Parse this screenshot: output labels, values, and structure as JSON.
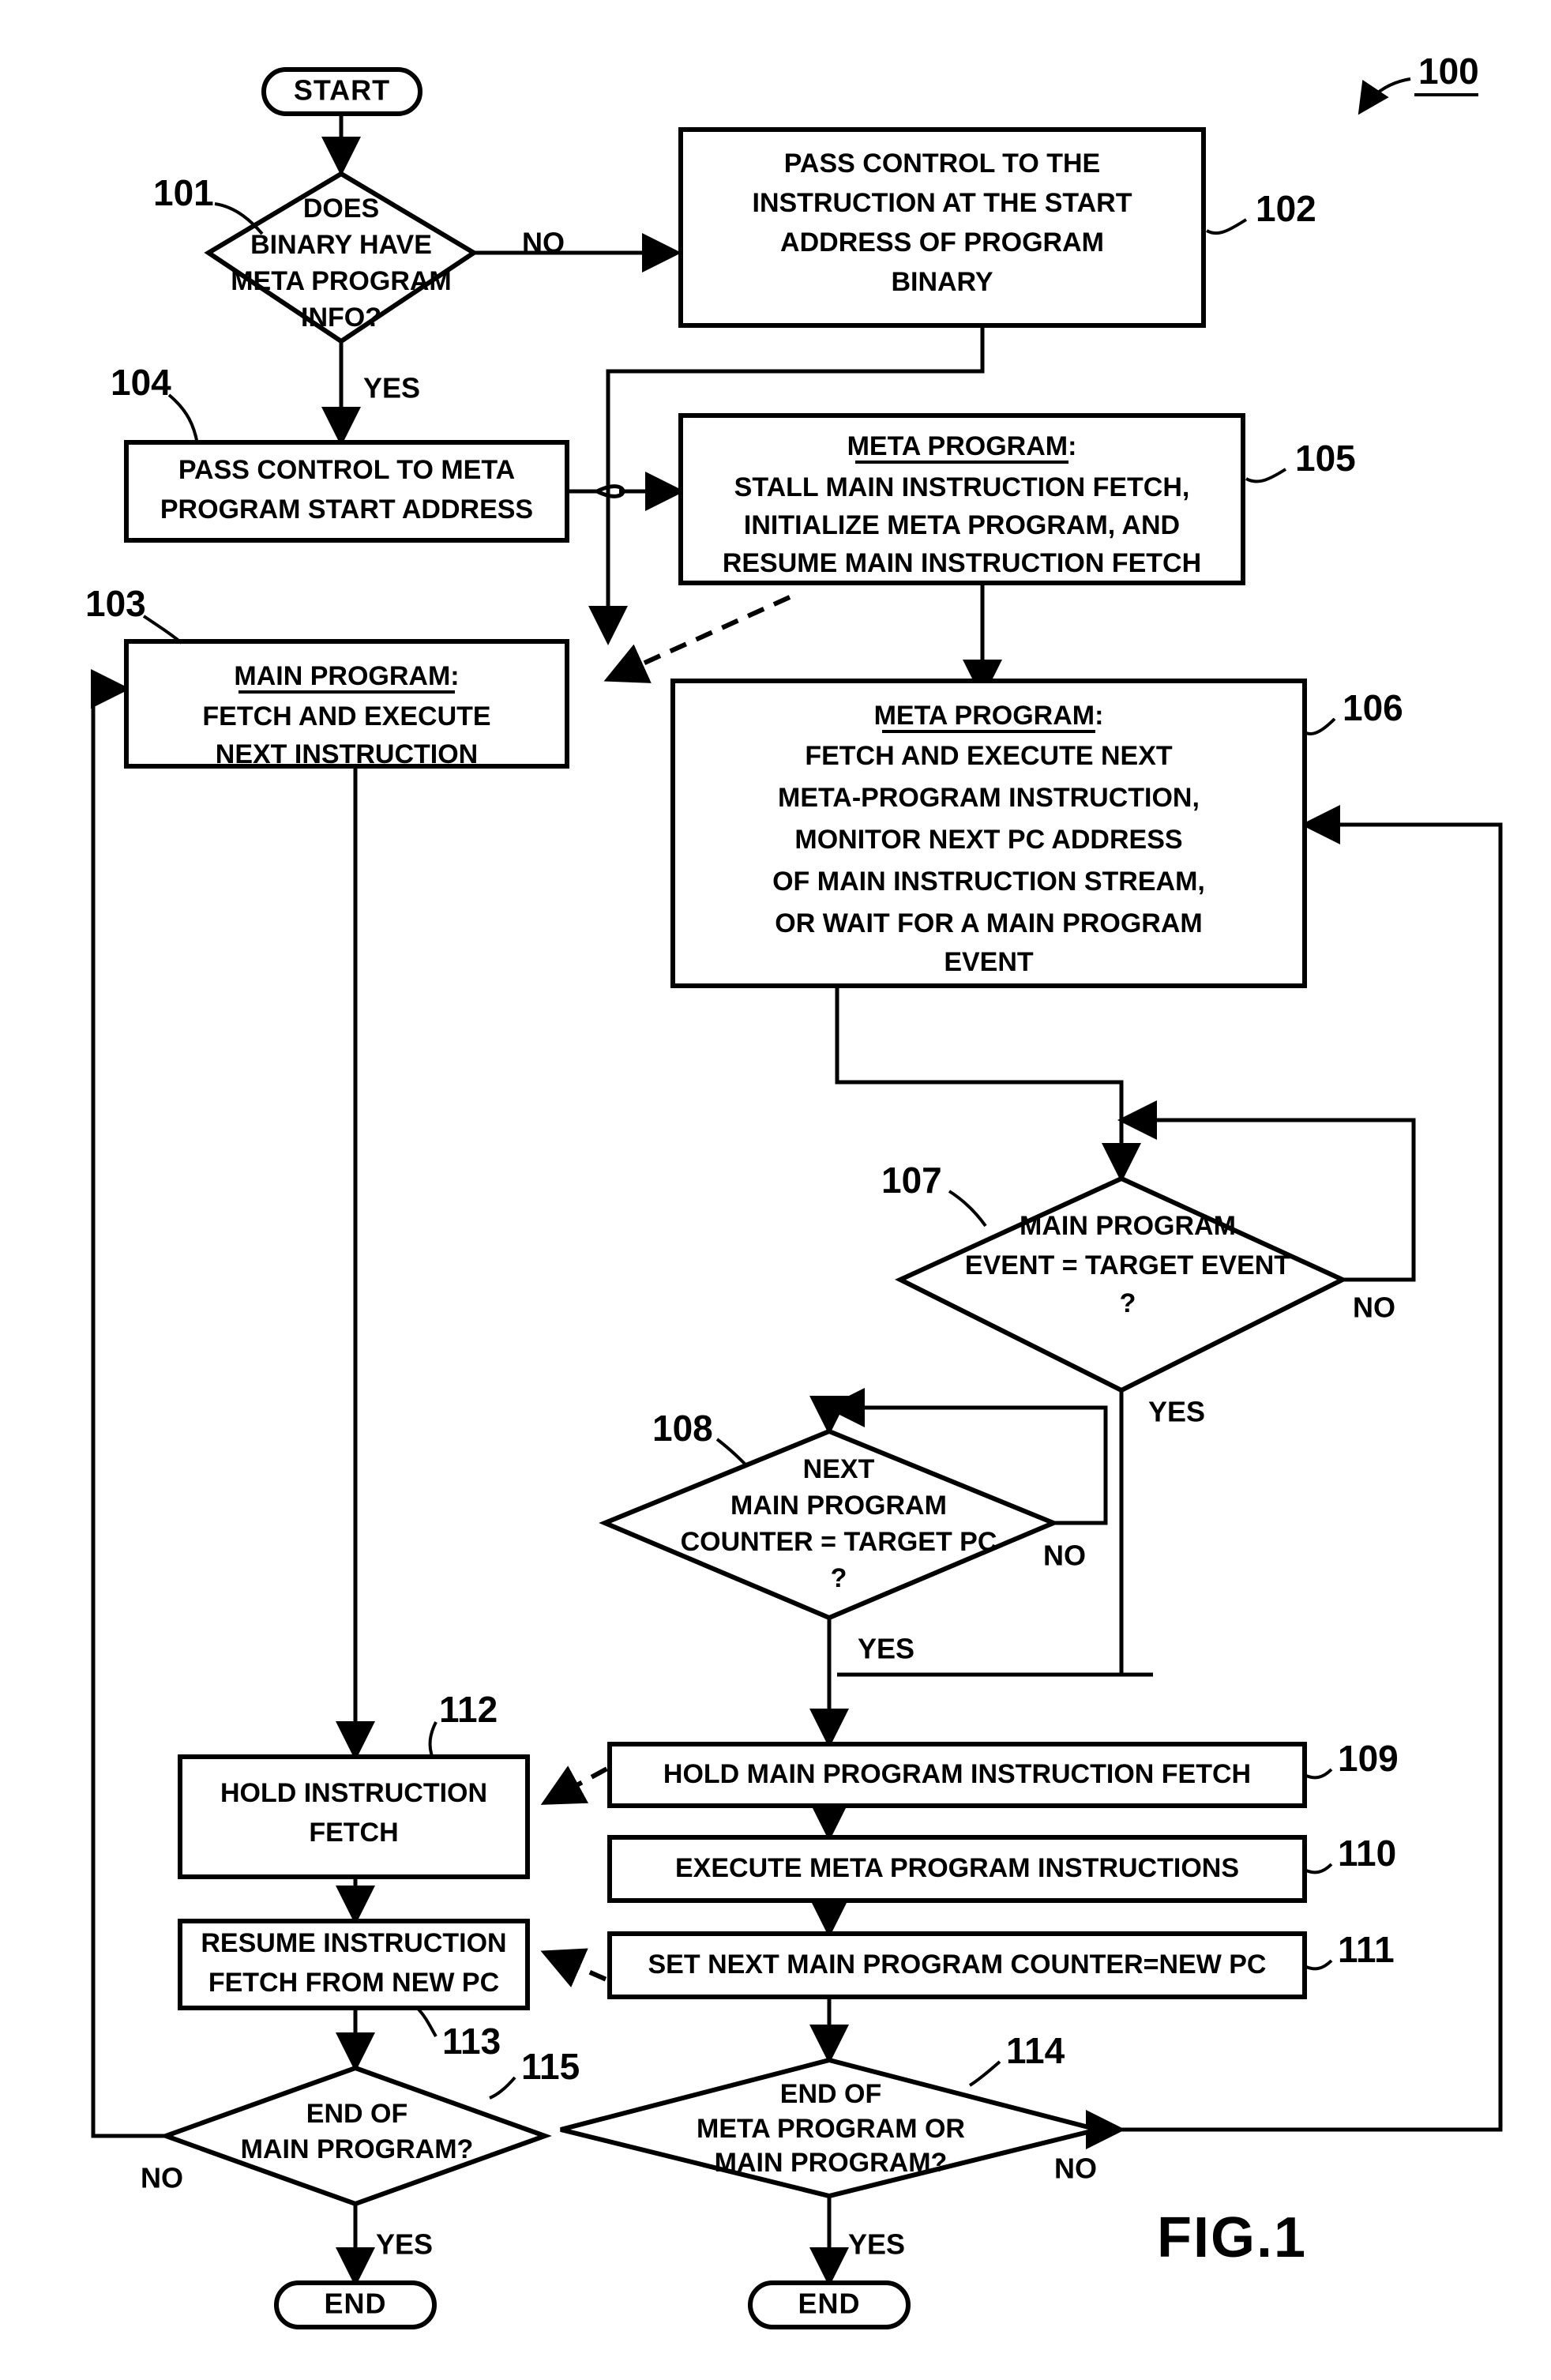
{
  "figure": {
    "label": "FIG.1",
    "reference": "100"
  },
  "nodes": {
    "start": {
      "ref": "",
      "lines": [
        "START"
      ]
    },
    "n101": {
      "ref": "101",
      "lines": [
        "DOES",
        "BINARY HAVE",
        "META PROGRAM",
        "INFO?"
      ]
    },
    "n102": {
      "ref": "102",
      "lines": [
        "PASS CONTROL TO THE",
        "INSTRUCTION AT THE START",
        "ADDRESS OF PROGRAM",
        "BINARY"
      ]
    },
    "n104": {
      "ref": "104",
      "lines": [
        "PASS CONTROL TO META",
        "PROGRAM START ADDRESS"
      ]
    },
    "n105": {
      "ref": "105",
      "heading": "META PROGRAM:",
      "lines": [
        "STALL MAIN INSTRUCTION FETCH,",
        "INITIALIZE META PROGRAM, AND",
        "RESUME MAIN INSTRUCTION FETCH"
      ]
    },
    "n103": {
      "ref": "103",
      "heading": "MAIN PROGRAM:",
      "lines": [
        "FETCH AND EXECUTE",
        "NEXT INSTRUCTION"
      ]
    },
    "n106": {
      "ref": "106",
      "heading": "META PROGRAM:",
      "lines": [
        "FETCH AND EXECUTE NEXT",
        "META-PROGRAM INSTRUCTION,",
        "MONITOR NEXT PC ADDRESS",
        "OF MAIN INSTRUCTION STREAM,",
        "OR WAIT FOR A MAIN PROGRAM",
        "EVENT"
      ]
    },
    "n107": {
      "ref": "107",
      "lines": [
        "MAIN PROGRAM",
        "EVENT = TARGET EVENT",
        "?"
      ]
    },
    "n108": {
      "ref": "108",
      "lines": [
        "NEXT",
        "MAIN PROGRAM",
        "COUNTER = TARGET PC",
        "?"
      ]
    },
    "n109": {
      "ref": "109",
      "lines": [
        "HOLD MAIN PROGRAM INSTRUCTION FETCH"
      ]
    },
    "n110": {
      "ref": "110",
      "lines": [
        "EXECUTE META PROGRAM INSTRUCTIONS"
      ]
    },
    "n111": {
      "ref": "111",
      "lines": [
        "SET NEXT MAIN PROGRAM COUNTER=NEW PC"
      ]
    },
    "n112": {
      "ref": "112",
      "lines": [
        "HOLD INSTRUCTION",
        "FETCH"
      ]
    },
    "n113": {
      "ref": "113",
      "lines": [
        "RESUME INSTRUCTION",
        "FETCH FROM NEW PC"
      ]
    },
    "n114": {
      "ref": "114",
      "lines": [
        "END OF",
        "META PROGRAM OR",
        "MAIN PROGRAM?"
      ]
    },
    "n115": {
      "ref": "115",
      "lines": [
        "END OF",
        "MAIN PROGRAM?"
      ]
    },
    "end_left": {
      "ref": "",
      "lines": [
        "END"
      ]
    },
    "end_right": {
      "ref": "",
      "lines": [
        "END"
      ]
    }
  },
  "branch_labels": {
    "b101_no": "NO",
    "b101_yes": "YES",
    "b107_no": "NO",
    "b107_yes": "YES",
    "b108_no": "NO",
    "b108_yes": "YES",
    "b114_no": "NO",
    "b114_yes": "YES",
    "b115_no": "NO",
    "b115_yes": "YES"
  },
  "colors": {
    "ink": "#000000",
    "paper": "#ffffff"
  }
}
